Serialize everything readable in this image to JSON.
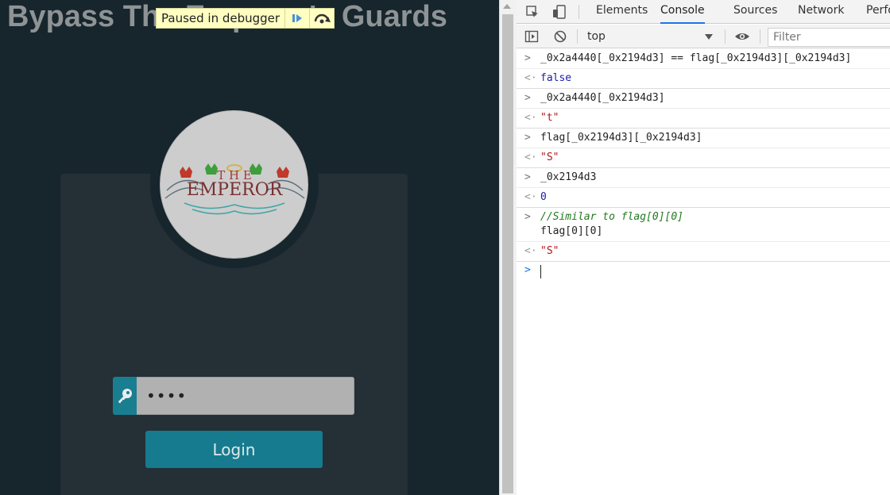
{
  "page": {
    "title": "Bypass The Emperor's Guards",
    "debugger_text": "Paused in debugger",
    "logo": {
      "top_letters": "T H E",
      "main_word": "EMPEROR"
    },
    "password": {
      "value": "••••"
    },
    "login_label": "Login",
    "colors": {
      "background": "#17252c",
      "card": "#242f36",
      "accent": "#167b8e"
    }
  },
  "devtools": {
    "tabs": [
      "Elements",
      "Console",
      "Sources",
      "Network",
      "Perfo"
    ],
    "active_tab": "Console",
    "context": "top",
    "filter_placeholder": "Filter"
  },
  "console": {
    "rows": [
      {
        "type": "input",
        "text": "_0x2a4440[_0x2194d3] == flag[_0x2194d3][_0x2194d3]"
      },
      {
        "type": "result",
        "text": "false"
      },
      {
        "type": "input",
        "text": "_0x2a4440[_0x2194d3]"
      },
      {
        "type": "result",
        "text": "\"t\""
      },
      {
        "type": "input",
        "text": "flag[_0x2194d3][_0x2194d3]"
      },
      {
        "type": "result",
        "text": "\"S\""
      },
      {
        "type": "input",
        "text": "_0x2194d3"
      },
      {
        "type": "result",
        "text": "0"
      },
      {
        "type": "input",
        "comment": "//Similar to flag[0][0]",
        "text": "flag[0][0]"
      },
      {
        "type": "result",
        "text": "\"S\""
      }
    ],
    "prompt": ""
  }
}
